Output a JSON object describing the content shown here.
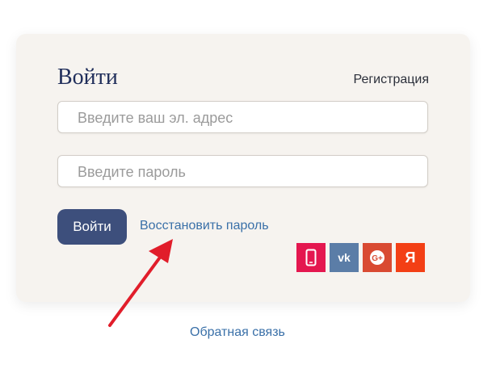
{
  "login": {
    "title": "Войти",
    "register_link": "Регистрация",
    "email_placeholder": "Введите ваш эл. адрес",
    "password_placeholder": "Введите пароль",
    "submit_label": "Войти",
    "restore_link": "Восстановить пароль"
  },
  "socials": [
    {
      "name": "phone",
      "glyph": "",
      "color": "#e4174f"
    },
    {
      "name": "vk",
      "glyph": "vk",
      "color": "#5b7da7"
    },
    {
      "name": "google-plus",
      "glyph": "G+",
      "color": "#d94a32"
    },
    {
      "name": "yandex",
      "glyph": "Я",
      "color": "#f33f15"
    }
  ],
  "footer": {
    "feedback_link": "Обратная связь"
  },
  "colors": {
    "primary_button": "#3d4f7c",
    "link": "#3a70a8",
    "card_background": "#f6f3ef",
    "annotation_arrow": "#e11d2a"
  },
  "icons": [
    "phone-icon",
    "vk-icon",
    "google-plus-icon",
    "yandex-icon",
    "annotation-arrow"
  ]
}
